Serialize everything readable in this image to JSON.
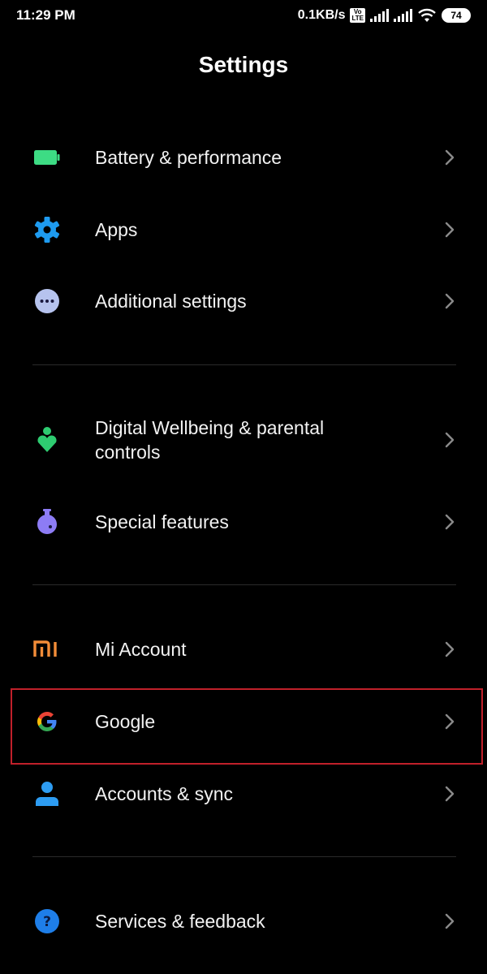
{
  "status_bar": {
    "time": "11:29 PM",
    "net_speed": "0.1KB/s",
    "volte_label": "Vo\nLTE",
    "battery": "74"
  },
  "header": {
    "title": "Settings"
  },
  "settings": {
    "battery": {
      "label": "Battery & performance",
      "icon": "battery-icon",
      "color": "#3ddc84"
    },
    "apps": {
      "label": "Apps",
      "icon": "gear-icon",
      "color": "#1e9bf0"
    },
    "additional": {
      "label": "Additional settings",
      "icon": "more-dots-icon",
      "color": "#b6c3ee"
    },
    "wellbeing": {
      "label_line1": "Digital Wellbeing & parental",
      "label_line2": "controls",
      "icon": "wellbeing-icon",
      "color": "#2ecc71"
    },
    "special": {
      "label": "Special features",
      "icon": "flask-icon",
      "color": "#8d7cf5"
    },
    "mi_account": {
      "label": "Mi Account",
      "icon": "mi-logo-icon",
      "color": "#f28c38"
    },
    "google": {
      "label": "Google",
      "icon": "google-logo-icon",
      "highlighted": true
    },
    "accounts": {
      "label": "Accounts & sync",
      "icon": "person-icon",
      "color": "#2d9cf2"
    },
    "services": {
      "label": "Services & feedback",
      "icon": "help-icon",
      "color": "#1e7ee8"
    }
  },
  "colors": {
    "highlight_border": "#c0202a",
    "chevron": "#8a8a8a"
  }
}
